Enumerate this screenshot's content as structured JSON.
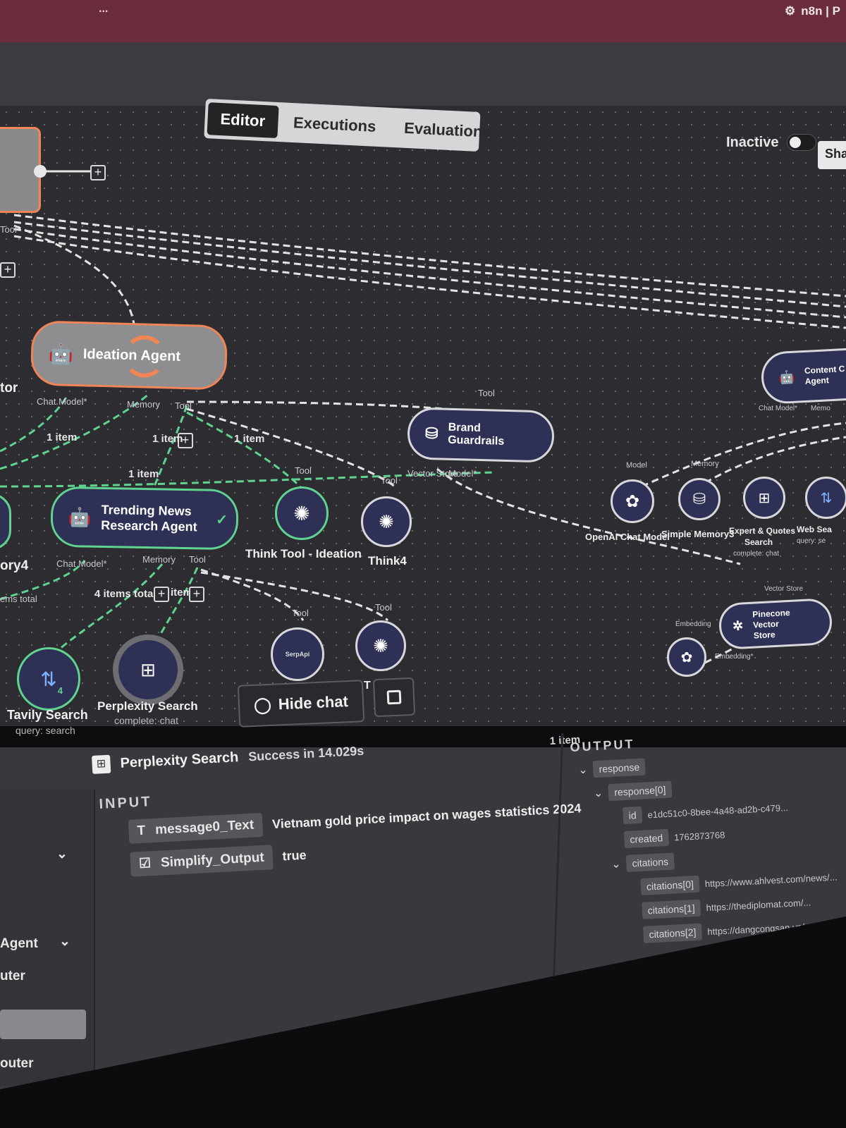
{
  "browser": {
    "tab_text": "n8n | P",
    "window_title": "..."
  },
  "header": {
    "tabs": [
      "Editor",
      "Executions",
      "Evaluations"
    ],
    "active_tab": "Editor",
    "status_label": "Inactive",
    "share_label": "Sha"
  },
  "nodes": {
    "ideation_agent": {
      "title": "Ideation Agent",
      "ports": [
        "Chat Model*",
        "Memory",
        "Tool"
      ]
    },
    "trending_news": {
      "title_line1": "Trending News",
      "title_line2": "Research Agent",
      "ports": [
        "Chat Model*",
        "Memory",
        "Tool"
      ]
    },
    "brand_guardrails": {
      "title": "Brand Guardrails",
      "tool_label": "Tool",
      "ports": [
        "Vector Store",
        "Model*"
      ]
    },
    "think_tool_ideation": {
      "title": "Think Tool - Ideation",
      "tool_label": "Tool"
    },
    "think4": {
      "title": "Think4",
      "tool_label": "Tool"
    },
    "serpapi": {
      "icon_text": "SerpApi",
      "tool_label": "Tool"
    },
    "think_bottom": {
      "tool_label": "Tool"
    },
    "tavily": {
      "title": "Tavily Search",
      "sub": "query: search",
      "badge": "4"
    },
    "perplexity": {
      "title": "Perplexity Search",
      "sub": "complete: chat"
    },
    "content_agent": {
      "title_line1": "Content C",
      "title_line2": "Agent",
      "ports": [
        "Chat Model*",
        "Memo"
      ]
    },
    "openai_chat": {
      "title": "OpenAI Chat Model",
      "port": "Model"
    },
    "simple_memory": {
      "title": "Simple Memory3",
      "port": "Memory"
    },
    "expert_quotes": {
      "title_line1": "Expert & Quotes",
      "title_line2": "Search",
      "sub": "complete: chat"
    },
    "web_search": {
      "title": "Web Sea",
      "sub": "query: se"
    },
    "pinecone": {
      "title_line1": "Pinecone Vector",
      "title_line2": "Store",
      "port_top": "Vector Store",
      "port_left": "Embedding",
      "port_bottom": "Embedding*"
    },
    "left_partial": {
      "label_tor": "tor",
      "label_ory4": "ory4",
      "label_items": "ems total",
      "tool": "Tool"
    }
  },
  "edge_labels": {
    "one_item_a": "1 item",
    "one_item_b": "1 item",
    "one_item_c": "1 item",
    "one_item_d": "1 item",
    "four_items": "4 items total",
    "item_e": "item"
  },
  "chat": {
    "hide_label": "Hide chat",
    "t_label": "T"
  },
  "panel": {
    "node_title": "Perplexity Search",
    "status": "Success in 14.029s",
    "item_count": "1 item",
    "input_heading": "INPUT",
    "output_heading": "OUTPUT",
    "inputs": [
      {
        "key": "message0_Text",
        "value": "Vietnam gold price impact on wages statistics 2024",
        "type_icon": "T"
      },
      {
        "key": "Simplify_Output",
        "value": "true",
        "type_icon": "☑"
      }
    ],
    "outputs": [
      {
        "key": "response",
        "value": ""
      },
      {
        "key": "response[0]",
        "value": ""
      },
      {
        "key": "id",
        "value": "e1dc51c0-8bee-4a48-ad2b-c479..."
      },
      {
        "key": "created",
        "value": "1762873768"
      },
      {
        "key": "citations",
        "value": ""
      },
      {
        "key": "citations[0]",
        "value": "https://www.ahlvest.com/news/..."
      },
      {
        "key": "citations[1]",
        "value": "https://thediplomat.com/..."
      },
      {
        "key": "citations[2]",
        "value": "https://dangcongsan.vn/..."
      }
    ],
    "left_items": [
      "Agent",
      "uter",
      "outer"
    ]
  },
  "colors": {
    "accent_orange": "#f08556",
    "node_navy": "#2e3056",
    "success_green": "#4fd38a",
    "canvas": "#2d2c30",
    "tabbar": "#6b2c3c"
  }
}
